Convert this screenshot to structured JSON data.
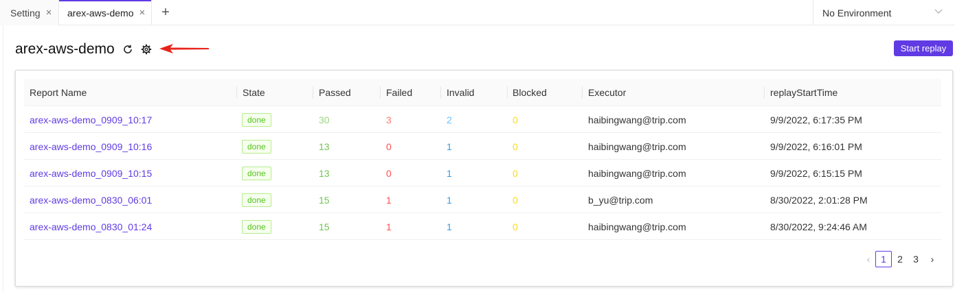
{
  "tabs": [
    {
      "label": "Setting"
    },
    {
      "label": "arex-aws-demo"
    }
  ],
  "environment": {
    "selected": "No Environment"
  },
  "header": {
    "title": "arex-aws-demo",
    "start_replay_label": "Start replay"
  },
  "colors": {
    "accent": "#603be3",
    "passed": "#73c254",
    "failed": "#ff4d4f",
    "invalid": "#3a9ad9",
    "blocked": "#fadb14"
  },
  "table": {
    "columns": [
      "Report Name",
      "State",
      "Passed",
      "Failed",
      "Invalid",
      "Blocked",
      "Executor",
      "replayStartTime"
    ],
    "rows": [
      {
        "name": "arex-aws-demo_0909_10:17",
        "state": "done",
        "passed": "30",
        "failed": "3",
        "invalid": "2",
        "blocked": "0",
        "executor": "haibingwang@trip.com",
        "time": "9/9/2022, 6:17:35 PM"
      },
      {
        "name": "arex-aws-demo_0909_10:16",
        "state": "done",
        "passed": "13",
        "failed": "0",
        "invalid": "1",
        "blocked": "0",
        "executor": "haibingwang@trip.com",
        "time": "9/9/2022, 6:16:01 PM"
      },
      {
        "name": "arex-aws-demo_0909_10:15",
        "state": "done",
        "passed": "13",
        "failed": "0",
        "invalid": "1",
        "blocked": "0",
        "executor": "haibingwang@trip.com",
        "time": "9/9/2022, 6:15:15 PM"
      },
      {
        "name": "arex-aws-demo_0830_06:01",
        "state": "done",
        "passed": "15",
        "failed": "1",
        "invalid": "1",
        "blocked": "0",
        "executor": "b_yu@trip.com",
        "time": "8/30/2022, 2:01:28 PM"
      },
      {
        "name": "arex-aws-demo_0830_01:24",
        "state": "done",
        "passed": "15",
        "failed": "1",
        "invalid": "1",
        "blocked": "0",
        "executor": "haibingwang@trip.com",
        "time": "8/30/2022, 9:24:46 AM"
      }
    ]
  },
  "pagination": {
    "pages": [
      "1",
      "2",
      "3"
    ],
    "current": "1"
  }
}
